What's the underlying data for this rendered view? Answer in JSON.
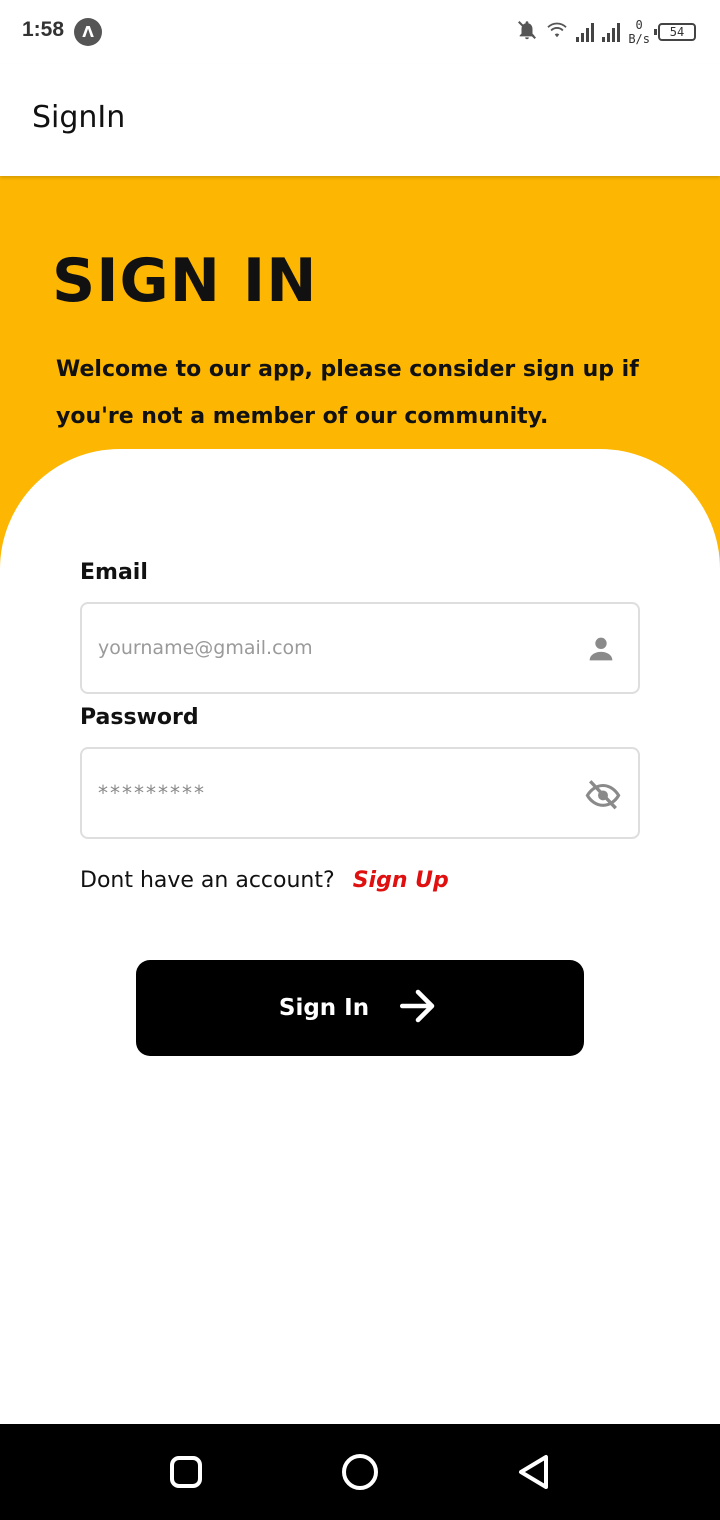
{
  "status_bar": {
    "time": "1:58",
    "app_icon_letter": "Λ",
    "speed_value": "0",
    "speed_unit": "B/s",
    "battery": "54",
    "icons": [
      "notifications-off-icon",
      "wifi-icon",
      "signal-icon",
      "signal-icon",
      "battery-icon"
    ]
  },
  "app_bar": {
    "title": "SignIn"
  },
  "hero": {
    "title": "SIGN IN",
    "subtitle": "Welcome to our app, please consider sign up if you're not a member of our community.",
    "color": "#fdb702"
  },
  "form": {
    "email": {
      "label": "Email",
      "placeholder": "yourname@gmail.com",
      "value": "",
      "icon": "person-icon"
    },
    "password": {
      "label": "Password",
      "value": "*********",
      "icon": "eye-off-icon"
    },
    "account_prompt": "Dont have an account?",
    "signup_link": "Sign Up",
    "signup_link_color": "#e01010",
    "submit_label": "Sign In",
    "submit_icon": "arrow-right-icon"
  },
  "nav_bar": {
    "buttons": [
      "recents-icon",
      "home-icon",
      "back-icon"
    ]
  }
}
